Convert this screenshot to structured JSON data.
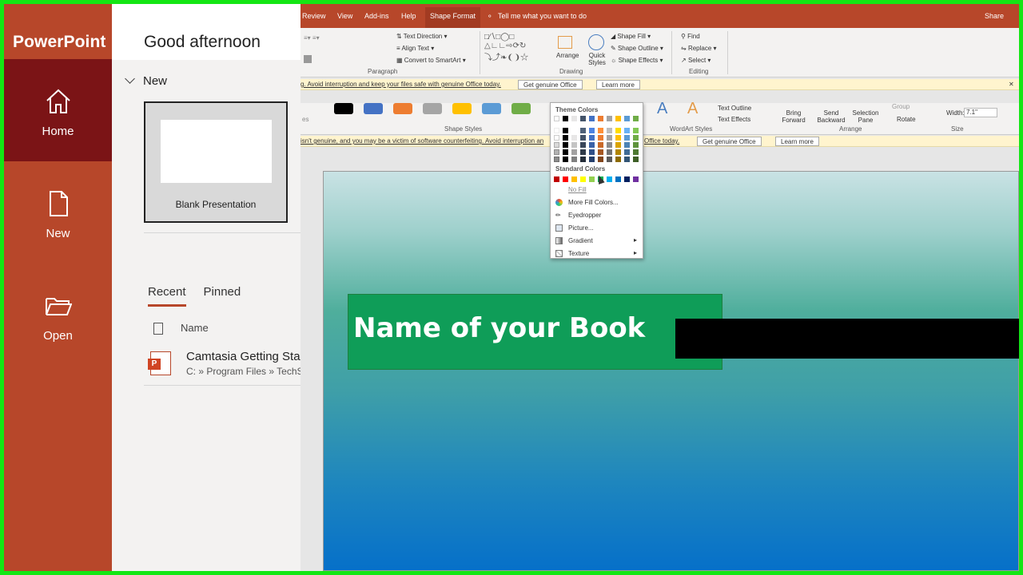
{
  "app_name": "PowerPoint",
  "nav": [
    {
      "label": "Home",
      "icon": "home-icon"
    },
    {
      "label": "New",
      "icon": "new-document-icon"
    },
    {
      "label": "Open",
      "icon": "folder-open-icon"
    }
  ],
  "greeting": "Good afternoon",
  "new_section": {
    "title": "New",
    "blank_label": "Blank Presentation"
  },
  "tabs": {
    "recent": "Recent",
    "pinned": "Pinned"
  },
  "file_list": {
    "column_name": "Name",
    "files": [
      {
        "name": "Camtasia Getting Star",
        "path": "C: » Program Files » TechSn"
      }
    ]
  },
  "ribbon_tabs": [
    "Review",
    "View",
    "Add-ins",
    "Help",
    "Shape Format"
  ],
  "tell_me": "Tell me what you want to do",
  "share": "Share",
  "ribbon": {
    "paragraph": {
      "text_direction": "Text Direction",
      "align_text": "Align Text",
      "convert_smartart": "Convert to SmartArt",
      "group": "Paragraph"
    },
    "drawing": {
      "arrange": "Arrange",
      "quick_styles": "Quick Styles",
      "shape_fill": "Shape Fill",
      "shape_outline": "Shape Outline",
      "shape_effects": "Shape Effects",
      "group": "Drawing"
    },
    "editing": {
      "find": "Find",
      "replace": "Replace",
      "select": "Select",
      "group": "Editing"
    }
  },
  "notice": {
    "msg1": "g. Avoid interruption and keep your files safe with genuine Office today.",
    "msg2_a": "isn't genuine, and you may be a victim of software counterfeiting. Avoid interruption an",
    "msg2_b": "Office today.",
    "get_genuine": "Get genuine Office",
    "learn_more": "Learn more"
  },
  "ribbon2": {
    "shape_styles": "Shape Styles",
    "wordart_styles": "WordArt Styles",
    "text_outline": "Text Outline",
    "text_effects": "Text Effects",
    "bring_forward": "Bring Forward",
    "send_backward": "Send Backward",
    "selection_pane": "Selection Pane",
    "group_item": "Group",
    "rotate": "Rotate",
    "arrange": "Arrange",
    "width_label": "Width:",
    "width_value": "7.1\"",
    "size": "Size",
    "styles_abbrev": "es",
    "wordart_letter": "A"
  },
  "color_menu": {
    "theme_colors": "Theme Colors",
    "standard_colors": "Standard Colors",
    "no_fill": "No Fill",
    "more_fill": "More Fill Colors...",
    "eyedropper": "Eyedropper",
    "picture": "Picture...",
    "gradient": "Gradient",
    "texture": "Texture"
  },
  "slide": {
    "title": "Name of your Book"
  },
  "colors": {
    "brand": "#b7472a",
    "active_nav": "#7b1416",
    "title_box": "#0f9d58",
    "frame": "#14e614"
  }
}
